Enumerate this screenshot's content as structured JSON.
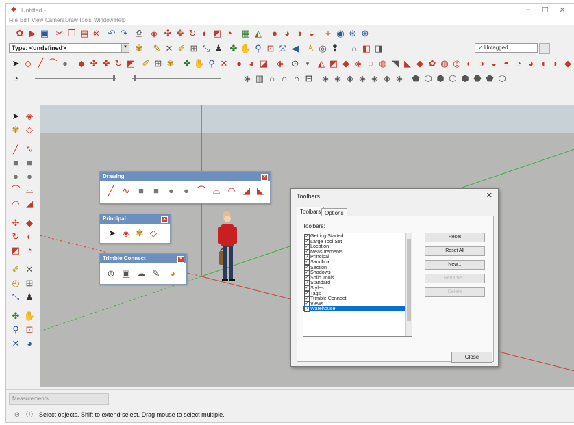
{
  "app": {
    "title": "Untitled - ",
    "win_controls": [
      "–",
      "☐",
      "✕"
    ]
  },
  "menu": [
    "File",
    "Edit",
    "View",
    "Camera",
    "Draw",
    "Tools",
    "Window",
    "Help"
  ],
  "toolbar": {
    "type_field": "Type: <undefined>",
    "tag_field": "✓  Untagged"
  },
  "palettes": {
    "drawing": {
      "title": "Drawing"
    },
    "principal": {
      "title": "Principal"
    },
    "trimble": {
      "title": "Trimble Connect"
    }
  },
  "dialog": {
    "title": "Toolbars",
    "close_glyph": "✕",
    "tabs": [
      "Toolbars",
      "Options"
    ],
    "list_label": "Toolbars:",
    "items": [
      {
        "label": "Getting Started",
        "checked": true
      },
      {
        "label": "Large Tool Set",
        "checked": true
      },
      {
        "label": "Location",
        "checked": true
      },
      {
        "label": "Measurements",
        "checked": true
      },
      {
        "label": "Principal",
        "checked": true
      },
      {
        "label": "Sandbox",
        "checked": true
      },
      {
        "label": "Section",
        "checked": true
      },
      {
        "label": "Shadows",
        "checked": true
      },
      {
        "label": "Solid Tools",
        "checked": true
      },
      {
        "label": "Standard",
        "checked": true
      },
      {
        "label": "Styles",
        "checked": true
      },
      {
        "label": "Tags",
        "checked": true
      },
      {
        "label": "Trimble Connect",
        "checked": true
      },
      {
        "label": "Views",
        "checked": true
      },
      {
        "label": "Warehouse",
        "checked": true,
        "selected": true
      }
    ],
    "buttons": {
      "reset": "Reset",
      "reset_all": "Reset All",
      "new": "New...",
      "rename": "Rename...",
      "delete": "Delete"
    },
    "close": "Close"
  },
  "measurements": {
    "label": "Measurements"
  },
  "status": {
    "text": "Select objects. Shift to extend select. Drag mouse to select multiple."
  },
  "colors": {
    "accent": "#0a6dd4",
    "palette_header": "#6d8fbf",
    "axis_blue": "#3a3ad0",
    "axis_red": "#d04030",
    "axis_green": "#3fb03f"
  }
}
